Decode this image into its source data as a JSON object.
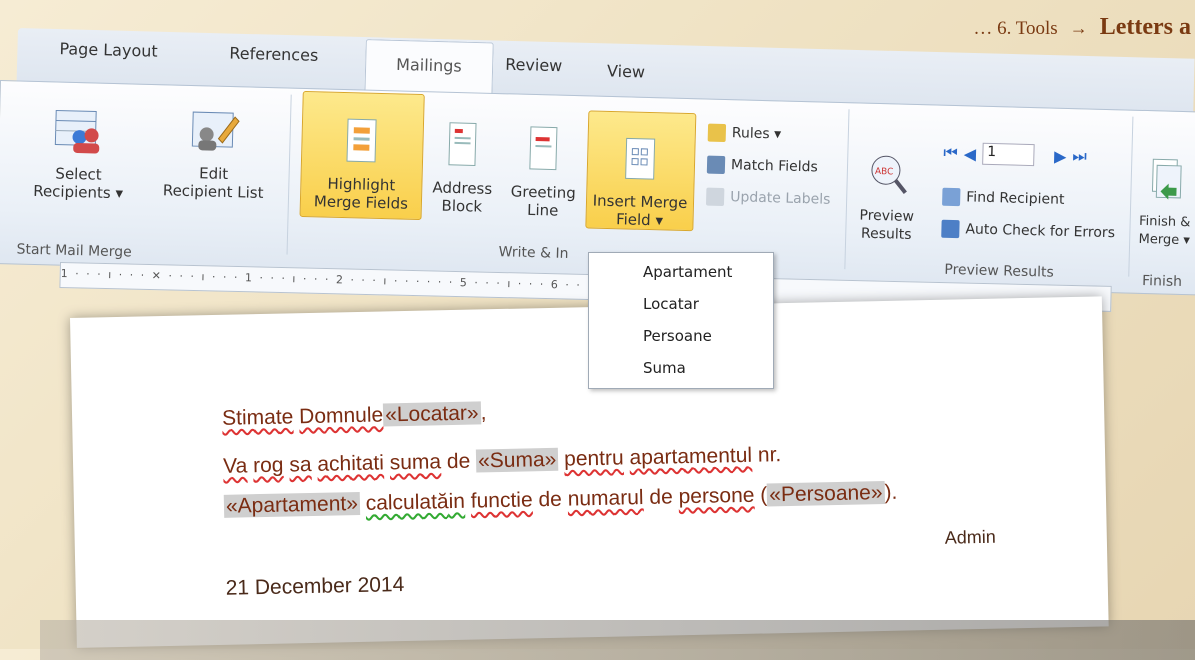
{
  "slide": {
    "prefix": "… 6. Tools",
    "arrow": "→",
    "title": "Letters a"
  },
  "tabs": {
    "page_layout": "Page Layout",
    "references": "References",
    "mailings": "Mailings",
    "review": "Review",
    "view": "View"
  },
  "ribbon": {
    "select_recipients": "Select\nRecipients ▾",
    "edit_list": "Edit\nRecipient List",
    "highlight": "Highlight\nMerge Fields",
    "address_block": "Address\nBlock",
    "greeting_line": "Greeting\nLine",
    "insert_merge": "Insert Merge\nField ▾",
    "rules": "Rules ▾",
    "match_fields": "Match Fields",
    "update_labels": "Update Labels",
    "preview_results": "Preview\nResults",
    "record_number": "1",
    "find_recipient": "Find Recipient",
    "auto_check": "Auto Check for Errors",
    "finish_merge": "Finish &\nMerge ▾",
    "group_start": "Start Mail Merge",
    "group_write": "Write & In",
    "group_preview": "Preview Results",
    "group_finish": "Finish"
  },
  "ruler": {
    "marks": "1 · · · ı · · · ✕ · · · ı · · · 1 · · · ı · · · 2 · · · ı · · ·                     · · · 5 · · · ı · · · 6 · · · ∧ · · · 7 · · ·"
  },
  "dropdown": {
    "items": [
      "Apartament",
      "Locatar",
      "Persoane",
      "Suma"
    ]
  },
  "document": {
    "salutation_prefix": "Stimate",
    "salutation_word": "Domnule",
    "field_locatar": "«Locatar»",
    "comma": ",",
    "l2_a": "Va",
    "l2_b": "rog",
    "l2_c": "sa",
    "l2_d": "achitati",
    "l2_e": "suma",
    "l2_f": "de",
    "field_suma": "«Suma»",
    "l2_g": "pentru",
    "l2_h": "apartamentul",
    "l2_i": "nr.",
    "field_apartament": "«Apartament»",
    "l3_a": "calculată",
    "l3_b": "in",
    "l3_c": "functie",
    "l3_d": "de",
    "l3_e": "numarul",
    "l3_f": "de",
    "l3_g": "persone",
    "l3_open": "(",
    "field_persoane": "«Persoane»",
    "l3_close": ").",
    "signature": "Admin",
    "date": "21 December 2014"
  }
}
